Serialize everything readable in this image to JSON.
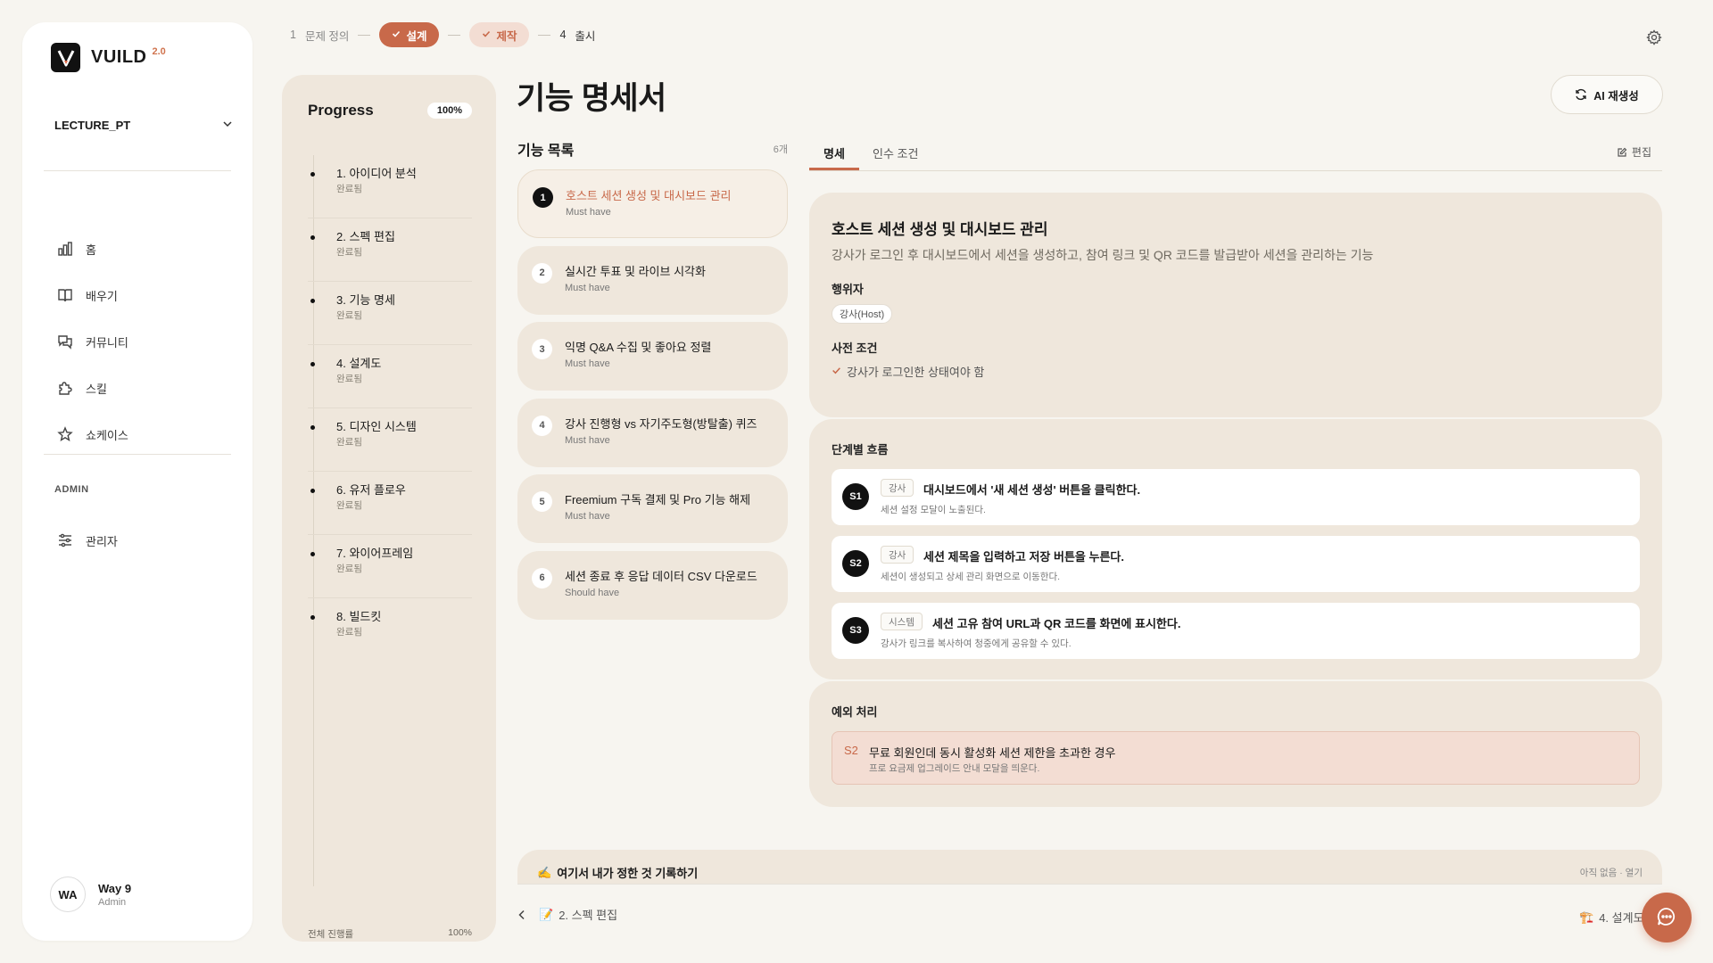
{
  "brand": {
    "name": "VUILD",
    "version": "2.0"
  },
  "project": {
    "name": "LECTURE_PT"
  },
  "nav": [
    {
      "label": "홈",
      "icon": "chart-icon"
    },
    {
      "label": "배우기",
      "icon": "book-icon"
    },
    {
      "label": "커뮤니티",
      "icon": "chat-icon"
    },
    {
      "label": "스킬",
      "icon": "puzzle-icon"
    },
    {
      "label": "쇼케이스",
      "icon": "star-icon"
    }
  ],
  "admin": {
    "section_label": "ADMIN",
    "item_label": "관리자"
  },
  "user": {
    "initials": "WA",
    "name": "Way 9",
    "role": "Admin"
  },
  "stepper": [
    {
      "num": "1",
      "label": "문제 정의",
      "state": "done-plain"
    },
    {
      "label": "설계",
      "state": "active"
    },
    {
      "label": "제작",
      "state": "done"
    },
    {
      "num": "4",
      "label": "출시",
      "state": "future"
    }
  ],
  "progress": {
    "title": "Progress",
    "percent_badge": "100%",
    "items": [
      {
        "name": "1. 아이디어 분석",
        "status": "완료됨"
      },
      {
        "name": "2. 스펙 편집",
        "status": "완료됨"
      },
      {
        "name": "3. 기능 명세",
        "status": "완료됨"
      },
      {
        "name": "4. 설계도",
        "status": "완료됨"
      },
      {
        "name": "5. 디자인 시스템",
        "status": "완료됨"
      },
      {
        "name": "6. 유저 플로우",
        "status": "완료됨"
      },
      {
        "name": "7. 와이어프레임",
        "status": "완료됨"
      },
      {
        "name": "8. 빌드킷",
        "status": "완료됨"
      }
    ],
    "footer_label": "전체 진행률",
    "footer_value": "100%"
  },
  "page": {
    "title": "기능 명세서",
    "regen_label": "AI 재생성"
  },
  "feature_list": {
    "title": "기능 목록",
    "count": "6개",
    "items": [
      {
        "num": "1",
        "title": "호스트 세션 생성 및 대시보드 관리",
        "priority": "Must have"
      },
      {
        "num": "2",
        "title": "실시간 투표 및 라이브 시각화",
        "priority": "Must have"
      },
      {
        "num": "3",
        "title": "익명 Q&A 수집 및 좋아요 정렬",
        "priority": "Must have"
      },
      {
        "num": "4",
        "title": "강사 진행형 vs 자기주도형(방탈출) 퀴즈",
        "priority": "Must have"
      },
      {
        "num": "5",
        "title": "Freemium 구독 결제 및 Pro 기능 해제",
        "priority": "Must have"
      },
      {
        "num": "6",
        "title": "세션 종료 후 응답 데이터 CSV 다운로드",
        "priority": "Should have"
      }
    ]
  },
  "tabs": {
    "spec": "명세",
    "acceptance": "인수 조건",
    "edit": "편집"
  },
  "detail": {
    "title": "호스트 세션 생성 및 대시보드 관리",
    "description": "강사가 로그인 후 대시보드에서 세션을 생성하고, 참여 링크 및 QR 코드를 발급받아 세션을 관리하는 기능",
    "actor_label": "행위자",
    "actor": "강사(Host)",
    "precondition_label": "사전 조건",
    "precondition": "강사가 로그인한 상태여야 함",
    "flow_label": "단계별 흐름",
    "steps": [
      {
        "id": "S1",
        "actor": "강사",
        "action": "대시보드에서 '새 세션 생성' 버튼을 클릭한다.",
        "result": "세션 설정 모달이 노출된다."
      },
      {
        "id": "S2",
        "actor": "강사",
        "action": "세션 제목을 입력하고 저장 버튼을 누른다.",
        "result": "세션이 생성되고 상세 관리 화면으로 이동한다."
      },
      {
        "id": "S3",
        "actor": "시스템",
        "action": "세션 고유 참여 URL과 QR 코드를 화면에 표시한다.",
        "result": "강사가 링크를 복사하여 청중에게 공유할 수 있다."
      }
    ],
    "exception_label": "예외 처리",
    "exception": {
      "ref": "S2",
      "condition": "무료 회원인데 동시 활성화 세션 제한을 초과한 경우",
      "action": "프로 요금제 업그레이드 안내 모달을 띄운다."
    }
  },
  "note": {
    "title": "여기서 내가 정한 것 기록하기",
    "status": "아직 없음 · 열기"
  },
  "pager": {
    "prev": "2. 스펙 편집",
    "next": "4. 설계도"
  },
  "colors": {
    "accent": "#c8694a",
    "panel": "#efe7dc",
    "background": "#f7f5f0"
  }
}
